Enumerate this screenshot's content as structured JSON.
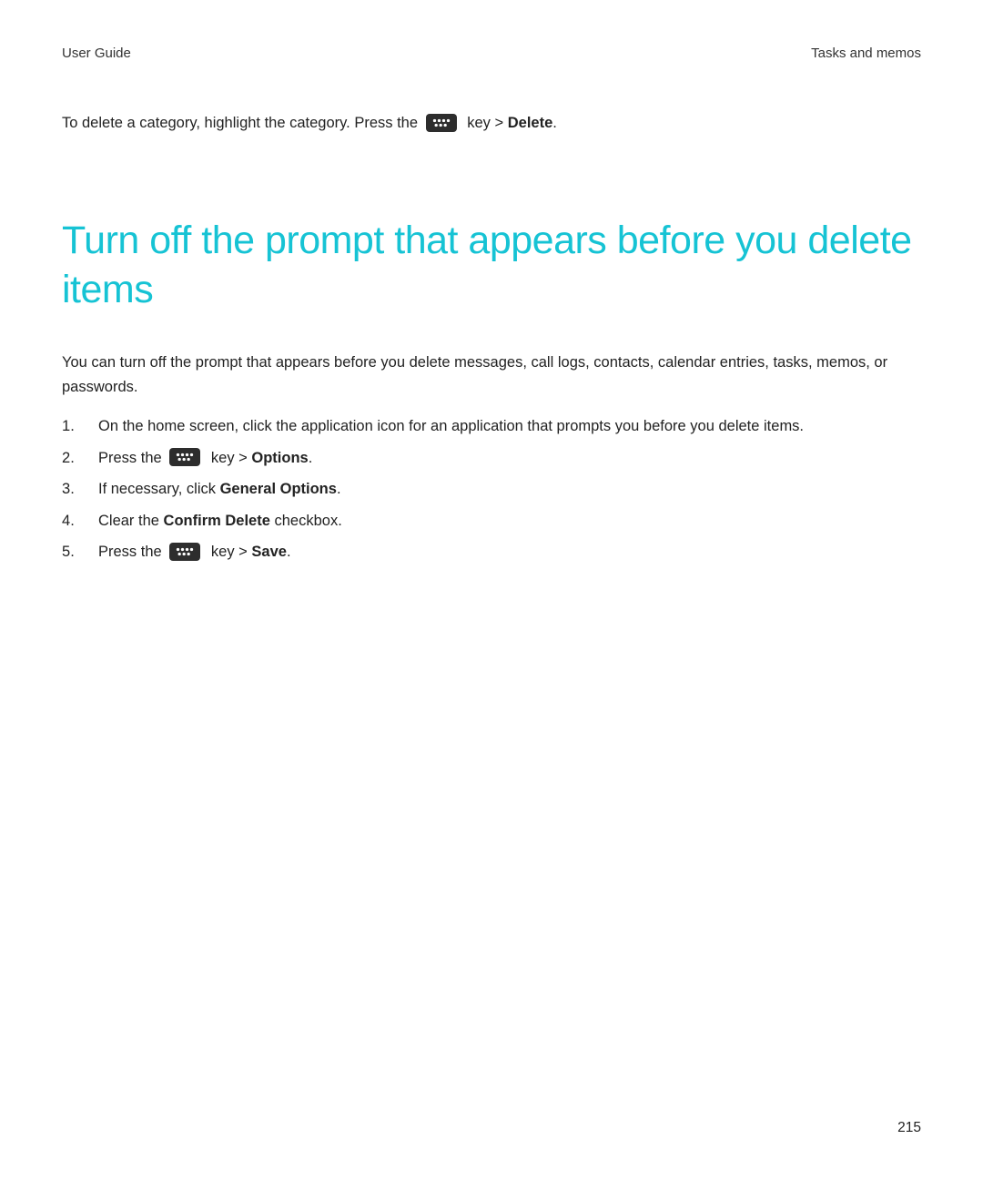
{
  "header": {
    "left": "User Guide",
    "right": "Tasks and memos"
  },
  "intro": {
    "prefix": "To delete a category, highlight the category. Press the",
    "key_after": "key >",
    "bold_word": "Delete",
    "period": "."
  },
  "heading": "Turn off the prompt that appears before you delete items",
  "description": "You can turn off the prompt that appears before you delete messages, call logs, contacts, calendar entries, tasks, memos, or passwords.",
  "steps": {
    "s1": "On the home screen, click the application icon for an application that prompts you before you delete items.",
    "s2": {
      "prefix": "Press the",
      "key_after": "key >",
      "bold_word": "Options",
      "period": "."
    },
    "s3": {
      "prefix": "If necessary, click",
      "bold_word": "General Options",
      "period": "."
    },
    "s4": {
      "prefix": "Clear the",
      "bold_word": "Confirm Delete",
      "suffix": "checkbox."
    },
    "s5": {
      "prefix": "Press the",
      "key_after": "key >",
      "bold_word": "Save",
      "period": "."
    }
  },
  "page_number": "215"
}
